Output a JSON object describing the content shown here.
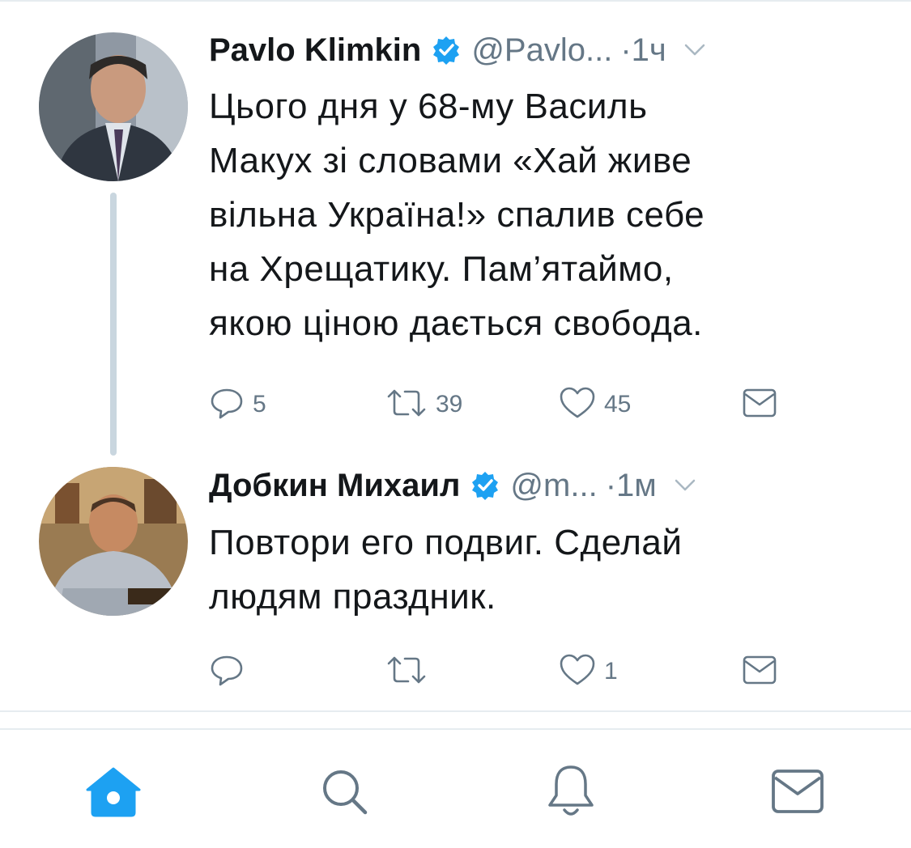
{
  "tweets": [
    {
      "name": "Pavlo Klimkin",
      "handle": "@Pavlo...",
      "dot": "·",
      "time": "1ч",
      "verified": true,
      "text_lines": [
        "Цього дня у 68-му Василь",
        "Макух зі словами «Хай живе",
        "вільна Україна!» спалив себе",
        "на Хрещатику. Пам’ятаймо,",
        "якою ціною дається свобода."
      ],
      "replies": "5",
      "retweets": "39",
      "likes": "45"
    },
    {
      "name": "Добкин Михаил",
      "handle": "@m...",
      "dot": "·",
      "time": "1м",
      "verified": true,
      "text_lines": [
        "Повтори его подвиг. Сделай",
        "людям праздник."
      ],
      "replies": "",
      "retweets": "",
      "likes": "1"
    }
  ],
  "tabbar": {
    "items": [
      "home-icon",
      "search-icon",
      "notifications-icon",
      "messages-icon"
    ],
    "active": "home-icon"
  },
  "colors": {
    "accent": "#1da1f2",
    "text": "#14171a",
    "secondary": "#657786",
    "border": "#e6ecf0",
    "thread_line": "#c9d6df"
  }
}
